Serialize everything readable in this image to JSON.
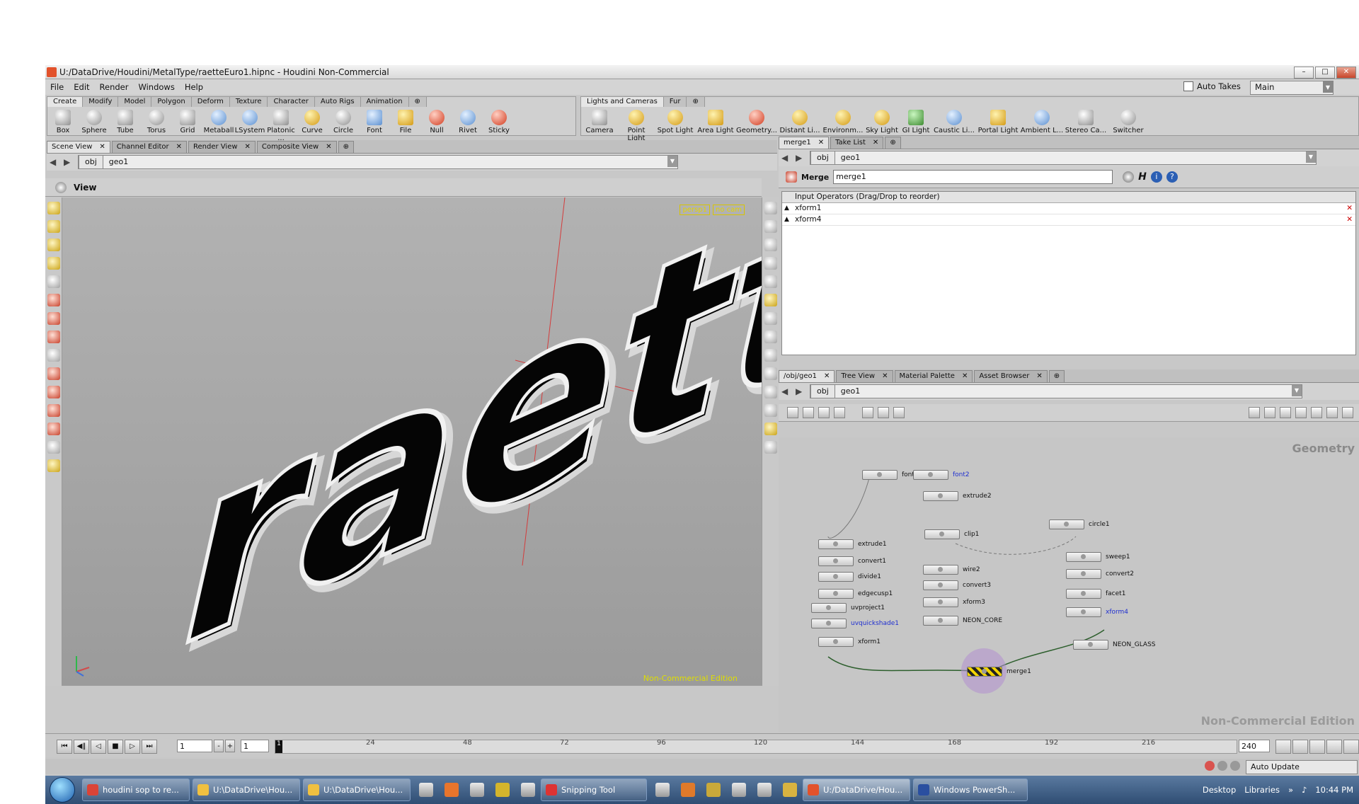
{
  "window": {
    "title": "U:/DataDrive/Houdini/MetalType/raetteEuro1.hipnc - Houdini Non-Commercial"
  },
  "menu": {
    "items": [
      "File",
      "Edit",
      "Render",
      "Windows",
      "Help"
    ],
    "auto_takes": "Auto Takes",
    "take": "Main"
  },
  "shelf_left": {
    "tabs": [
      "Create",
      "Modify",
      "Model",
      "Polygon",
      "Deform",
      "Texture",
      "Character",
      "Auto Rigs",
      "Animation"
    ],
    "tools": [
      "Box",
      "Sphere",
      "Tube",
      "Torus",
      "Grid",
      "Metaball",
      "LSystem",
      "Platonic ...",
      "Curve",
      "Circle",
      "Font",
      "File",
      "Null",
      "Rivet",
      "Sticky"
    ]
  },
  "shelf_right": {
    "tabs": [
      "Lights and Cameras",
      "Fur"
    ],
    "tools": [
      "Camera",
      "Point Light",
      "Spot Light",
      "Area Light",
      "Geometry...",
      "Distant Li...",
      "Environm...",
      "Sky Light",
      "GI Light",
      "Caustic Li...",
      "Portal Light",
      "Ambient L...",
      "Stereo Ca...",
      "Switcher"
    ]
  },
  "scene_pane": {
    "tabs": [
      "Scene View",
      "Channel Editor",
      "Render View",
      "Composite View"
    ],
    "path": [
      "obj",
      "geo1"
    ],
    "view_title": "View",
    "cam_labels": [
      "persp1",
      "no cam"
    ],
    "watermark": "Non-Commercial Edition",
    "scene_text": "raette"
  },
  "param_pane": {
    "tabs": [
      "merge1",
      "Take List"
    ],
    "path": [
      "obj",
      "geo1"
    ],
    "node_type": "Merge",
    "node_name": "merge1",
    "list_header": "Input Operators (Drag/Drop to reorder)",
    "inputs": [
      "xform1",
      "xform4"
    ]
  },
  "network_pane": {
    "tabs": [
      "/obj/geo1",
      "Tree View",
      "Material Palette",
      "Asset Browser"
    ],
    "path": [
      "obj",
      "geo1"
    ],
    "context_label": "Geometry",
    "watermark": "Non-Commercial Edition",
    "nodes": [
      {
        "name": "font1",
        "blue": false
      },
      {
        "name": "font2",
        "blue": true
      },
      {
        "name": "extrude2",
        "blue": false
      },
      {
        "name": "circle1",
        "blue": false
      },
      {
        "name": "extrude1",
        "blue": false
      },
      {
        "name": "clip1",
        "blue": false
      },
      {
        "name": "sweep1",
        "blue": false
      },
      {
        "name": "convert1",
        "blue": false
      },
      {
        "name": "divide1",
        "blue": false
      },
      {
        "name": "wire2",
        "blue": false
      },
      {
        "name": "convert2",
        "blue": false
      },
      {
        "name": "convert3",
        "blue": false
      },
      {
        "name": "edgecusp1",
        "blue": false
      },
      {
        "name": "facet1",
        "blue": false
      },
      {
        "name": "uvproject1",
        "blue": false
      },
      {
        "name": "xform3",
        "blue": false
      },
      {
        "name": "xform4",
        "blue": true
      },
      {
        "name": "uvquickshade1",
        "blue": true
      },
      {
        "name": "NEON_CORE",
        "blue": false
      },
      {
        "name": "xform1",
        "blue": false
      },
      {
        "name": "NEON_GLASS",
        "blue": false
      },
      {
        "name": "merge1",
        "blue": false
      }
    ]
  },
  "timeline": {
    "current_frame": "1",
    "start_frame": "1",
    "end_frame": "240",
    "ticks": [
      "24",
      "48",
      "72",
      "96",
      "120",
      "144",
      "168",
      "192",
      "216"
    ],
    "auto_update": "Auto Update"
  },
  "taskbar": {
    "tasks": [
      "houdini sop to re...",
      "U:\\DataDrive\\Hou...",
      "U:\\DataDrive\\Hou...",
      "Snipping Tool",
      "U:/DataDrive/Hou...",
      "Windows PowerSh..."
    ],
    "tray": [
      "Desktop",
      "Libraries"
    ],
    "clock": "10:44 PM"
  }
}
